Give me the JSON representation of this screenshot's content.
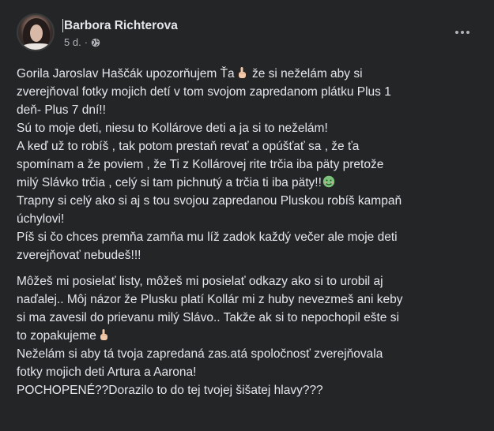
{
  "post": {
    "author": "Barbora Richterova",
    "time": "5 d.",
    "separator": "·",
    "privacy_icon": "globe-icon",
    "menu_icon": "more-horizontal-icon",
    "paragraph1": [
      {
        "before": "Gorila Jaroslav Haščák upozorňujem Ťa",
        "emoji": "pointing-up-emoji",
        "after": " že si neželám aby si"
      },
      {
        "text": "zverejňoval fotky mojich detí v tom svojom zapredanom plátku Plus 1"
      },
      {
        "text": "deň- Plus 7 dní!!"
      },
      {
        "text": "Sú to moje deti, niesu to Kollárove deti a ja si to neželám!"
      },
      {
        "text": "A keď už to robíš , tak potom prestaň revať  a opúšťať sa , že ťa"
      },
      {
        "text": "spomínam a že poviem , že Ti z Kollárovej rite trčia iba päty pretože"
      },
      {
        "before": "milý Slávko trčia , celý si tam pichnutý a trčia ti iba päty!!",
        "emoji": "nauseated-face-emoji",
        "after": ""
      },
      {
        "text": "Trapny si celý ako si aj s tou svojou zapredanou Pluskou robíš kampaň"
      },
      {
        "text": "úchylovi!"
      },
      {
        "text": "Píš si čo chces premňa zamňa mu líž zadok každý večer ale moje deti"
      },
      {
        "text": "zverejňovať nebudeš!!!"
      }
    ],
    "paragraph2": [
      {
        "text": "Môžeš mi posielať listy, môžeš mi posielať odkazy ako si to urobil aj"
      },
      {
        "text": "naďalej.. Môj názor že Plusku platí Kollár mi z huby nevezmeš ani keby"
      },
      {
        "text": "si ma zavesil do prievanu milý Slávo.. Takže ak si to nepochopil ešte si"
      },
      {
        "before": "to zopakujeme",
        "emoji": "pointing-up-emoji",
        "after": ""
      },
      {
        "text": "Neželám si aby tá tvoja zapredaná zas.atá  spoločnosť zverejňovala"
      },
      {
        "text": "fotky mojich deti Artura a Aarona!"
      },
      {
        "text": "POCHOPENÉ??Dorazilo to do tej tvojej šišatej hlavy???"
      }
    ]
  },
  "colors": {
    "background": "#242526",
    "primary_text": "#e4e6eb",
    "secondary_text": "#b0b3b8"
  }
}
